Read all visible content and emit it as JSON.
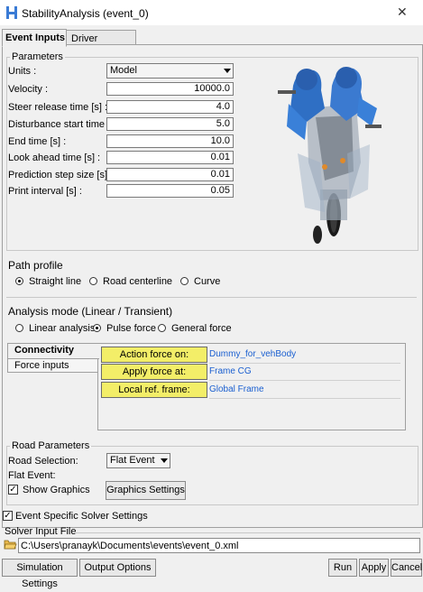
{
  "window": {
    "title": "StabilityAnalysis (event_0)",
    "close_glyph": "✕"
  },
  "tabs": [
    {
      "label": "Event Inputs"
    },
    {
      "label": "Driver"
    }
  ],
  "parameters": {
    "legend": "Parameters",
    "units_label": "Units :",
    "units_value": "Model",
    "fields": [
      {
        "label": "Velocity :",
        "value": "10000.0"
      },
      {
        "label": "Steer release time [s] :",
        "value": "4.0"
      },
      {
        "label": "Disturbance start time [s] :",
        "value": "5.0"
      },
      {
        "label": "End time [s] :",
        "value": "10.0"
      },
      {
        "label": "Look ahead time [s] :",
        "value": "0.01"
      },
      {
        "label": "Prediction step size [s] :",
        "value": "0.01"
      },
      {
        "label": "Print interval [s] :",
        "value": "0.05"
      }
    ]
  },
  "path_profile": {
    "title": "Path profile",
    "options": [
      {
        "label": "Straight line",
        "selected": true
      },
      {
        "label": "Road centerline",
        "selected": false
      },
      {
        "label": "Curve",
        "selected": false
      }
    ]
  },
  "analysis_mode": {
    "title": "Analysis mode (Linear / Transient)",
    "options": [
      {
        "label": "Linear analysis",
        "selected": false
      },
      {
        "label": "Pulse force",
        "selected": true
      },
      {
        "label": "General force",
        "selected": false
      }
    ]
  },
  "side_tabs": [
    {
      "label": "Connectivity"
    },
    {
      "label": "Force inputs"
    }
  ],
  "connectivity": [
    {
      "label": "Action force on:",
      "value": "Dummy_for_vehBody"
    },
    {
      "label": "Apply force at:",
      "value": "Frame CG"
    },
    {
      "label": "Local ref. frame:",
      "value": "Global Frame"
    }
  ],
  "road": {
    "legend": "Road Parameters",
    "selection_label": "Road Selection:",
    "selection_value": "Flat Event",
    "flat_event_label": "Flat Event:",
    "show_graphics_label": "Show Graphics",
    "show_graphics_checked": true,
    "graphics_settings_button": "Graphics Settings"
  },
  "event_specific": {
    "label": "Event Specific Solver Settings",
    "checked": true
  },
  "solver_input": {
    "label": "Solver Input File",
    "path": "C:\\Users\\pranayk\\Documents\\events\\event_0.xml"
  },
  "buttons": {
    "simulation_settings": "Simulation Settings",
    "output_options": "Output Options",
    "run": "Run",
    "apply": "Apply",
    "cancel": "Cancel"
  },
  "colors": {
    "highlight": "#f3ee68",
    "value_text": "#1a5fd0",
    "motorcycle": "#2f6fc4"
  }
}
